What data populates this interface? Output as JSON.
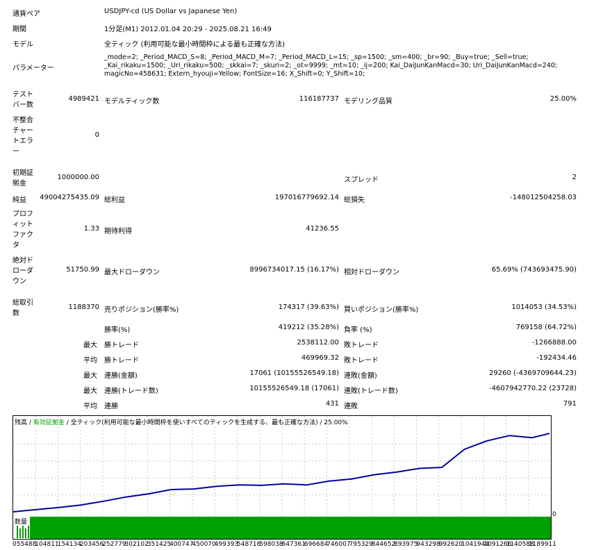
{
  "header": {
    "pair_label": "通貨ペア",
    "pair_value": "USDJPY-cd (US Dollar vs Japanese Yen)",
    "period_label": "期間",
    "period_value": "1分足(M1) 2012.01.04 20:29 - 2025.08.21 16:49",
    "model_label": "モデル",
    "model_value": "全ティック (利用可能な最小時間枠による最も正確な方法)",
    "params_label": "パラメーター",
    "params_line1": "_mode=2; _Period_MACD_S=8; _Period_MACD_M=7; _Period_MACD_L=15; _sp=1500; _sm=400; _br=90; _Buy=true; _Sell=true;",
    "params_line2": "_Kai_rikaku=1500; _Uri_rikaku=500; _skkai=7; _skuri=2; _ot=9999; _mt=10; _ij=200; Kai_DaiJunKanMacd=30; Uri_DaiJunKanMacd=240;",
    "params_line3": "magicNo=458631; Extern_hyouji=Yellow; FontSize=16; X_Shift=0; Y_Shift=10;"
  },
  "stats": {
    "bars_label": "テスト\nバー数",
    "bars_value": "4989421",
    "ticks_label": "モデルティック数",
    "ticks_value": "116187737",
    "quality_label": "モデリング品質",
    "quality_value": "25.00%",
    "mismatch_label": "不整合\nチャー\nトエラ\nー",
    "mismatch_value": "0",
    "deposit_label": "初期証\n拠金",
    "deposit_value": "1000000.00",
    "spread_label": "スプレッド",
    "spread_value": "2",
    "net_label": "純益",
    "net_value": "49004275435.09",
    "gross_profit_label": "総利益",
    "gross_profit_value": "197016779692.14",
    "gross_loss_label": "総損失",
    "gross_loss_value": "-148012504258.03",
    "pf_label": "プロフ\nィット\nファク\nタ",
    "pf_value": "1.33",
    "expected_label": "期待利得",
    "expected_value": "41236.55",
    "abs_dd_label": "絶対ド\nローダ\nウン",
    "abs_dd_value": "51750.99",
    "max_dd_label": "最大ドローダウン",
    "max_dd_value": "8996734017.15 (16.17%)",
    "rel_dd_label": "相対ドローダウン",
    "rel_dd_value": "65.69% (743693475.90)",
    "total_trades_label": "総取引\n数",
    "total_trades_value": "1188370",
    "short_label": "売りポジション(勝率%)",
    "short_value": "174317 (39.63%)",
    "long_label": "買いポジション(勝率%)",
    "long_value": "1014053 (34.53%)",
    "win_label": "勝率(%)",
    "win_value": "419212 (35.28%)",
    "loss_label": "負率 (%)",
    "loss_value": "769158 (64.72%)",
    "max_word": "最大",
    "avg_word": "平均",
    "max_win_label": "勝トレード",
    "max_win_value": "2538112.00",
    "max_loss_label": "敗トレード",
    "max_loss_value": "-1266888.00",
    "avg_win_label": "勝トレード",
    "avg_win_value": "469969.32",
    "avg_loss_label": "敗トレード",
    "avg_loss_value": "-192434.46",
    "max_cons_win_amt_label": "連勝(金額)",
    "max_cons_win_amt_value": "17061 (10155526549.18)",
    "max_cons_loss_amt_label": "連敗(金額)",
    "max_cons_loss_amt_value": "29260 (-4369709644.23)",
    "max_cons_win_cnt_label": "連勝(トレード数)",
    "max_cons_win_cnt_value": "10155526549.18 (17061)",
    "max_cons_loss_cnt_label": "連敗(トレード数)",
    "max_cons_loss_cnt_value": "-4607942770.22 (23728)",
    "avg_cons_win_label": "連勝",
    "avg_cons_win_value": "431",
    "avg_cons_loss_label": "連敗",
    "avg_cons_loss_value": "791"
  },
  "chart": {
    "legend_balance": "残高",
    "legend_equity": "有効証拠金",
    "legend_model": "全ティック(利用可能な最小時間枠を使いすべてのティックを生成する、最も正確な方法)",
    "legend_quality": "25.00%",
    "legend_sep": "/",
    "zero_label": "0",
    "volume_label": "数量",
    "colors": {
      "balance": "#0000a0",
      "volume": "#00a000",
      "grid": "#c8c8c8",
      "legend_equity": "#00a000"
    },
    "x_ticks": [
      "055488",
      "104811",
      "154134",
      "203456",
      "252779",
      "302102",
      "351425",
      "400747",
      "450070",
      "499393",
      "548716",
      "598038",
      "647361",
      "696684",
      "746007",
      "795329",
      "844652",
      "893975",
      "943298",
      "992620",
      "1041944",
      "1091266",
      "1140588",
      "1189911"
    ]
  },
  "chart_data": {
    "type": "line",
    "title": "",
    "xlabel": "",
    "ylabel": "",
    "x": [
      0,
      50000,
      100000,
      150000,
      200000,
      250000,
      300000,
      350000,
      400000,
      450000,
      500000,
      550000,
      600000,
      650000,
      700000,
      750000,
      800000,
      850000,
      900000,
      950000,
      1000000,
      1050000,
      1100000,
      1150000,
      1188370
    ],
    "series": [
      {
        "name": "残高",
        "values": [
          0.001,
          1.0,
          2.0,
          3.2,
          5.0,
          7.0,
          8.5,
          10.5,
          10.8,
          12.0,
          12.7,
          12.5,
          13.2,
          12.7,
          14.5,
          15.5,
          17.5,
          18.8,
          20.5,
          21.0,
          29.5,
          33.5,
          36.0,
          35.0,
          37.0
        ]
      }
    ],
    "ylim": [
      0,
      40
    ]
  }
}
